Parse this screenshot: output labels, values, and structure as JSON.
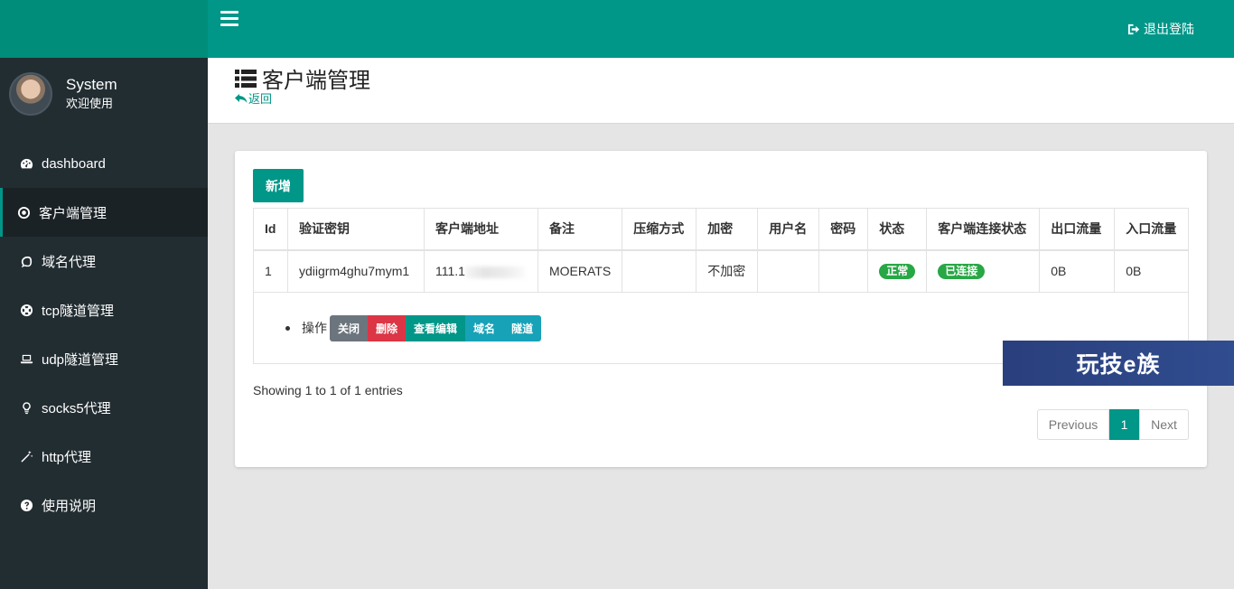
{
  "header": {
    "logout_label": "退出登陆"
  },
  "user": {
    "name": "System",
    "welcome": "欢迎使用"
  },
  "sidebar": {
    "items": [
      {
        "label": "dashboard",
        "icon": "dashboard-icon"
      },
      {
        "label": "客户端管理",
        "icon": "dot-circle-icon",
        "active": true
      },
      {
        "label": "域名代理",
        "icon": "comment-icon"
      },
      {
        "label": "tcp隧道管理",
        "icon": "life-ring-icon"
      },
      {
        "label": "udp隧道管理",
        "icon": "laptop-icon"
      },
      {
        "label": "socks5代理",
        "icon": "lightbulb-icon"
      },
      {
        "label": "http代理",
        "icon": "magic-wand-icon"
      },
      {
        "label": "使用说明",
        "icon": "question-circle-icon"
      }
    ]
  },
  "page": {
    "title": "客户端管理",
    "back_label": "返回"
  },
  "toolbar": {
    "add_label": "新增"
  },
  "table": {
    "columns": [
      "Id",
      "验证密钥",
      "客户端地址",
      "备注",
      "压缩方式",
      "加密",
      "用户名",
      "密码",
      "状态",
      "客户端连接状态",
      "出口流量",
      "入口流量"
    ],
    "row": {
      "id": "1",
      "key": "ydiigrm4ghu7mym1",
      "address": "111.1",
      "remark": "MOERATS",
      "compress": "",
      "encrypt": "不加密",
      "username": "",
      "password": "",
      "status": "正常",
      "conn_status": "已连接",
      "out_flow": "0B",
      "in_flow": "0B"
    },
    "ops": {
      "label": "操作",
      "close": "关闭",
      "delete": "删除",
      "edit": "查看编辑",
      "domain": "域名",
      "tunnel": "隧道"
    }
  },
  "footer": {
    "info": "Showing 1 to 1 of 1 entries",
    "prev": "Previous",
    "page": "1",
    "next": "Next"
  },
  "watermark": "玩技e族",
  "colors": {
    "primary": "#009688",
    "sidebar": "#222d32",
    "success": "#28a745",
    "danger": "#dc3545",
    "info": "#17a2b8",
    "secondary": "#6c757d"
  }
}
